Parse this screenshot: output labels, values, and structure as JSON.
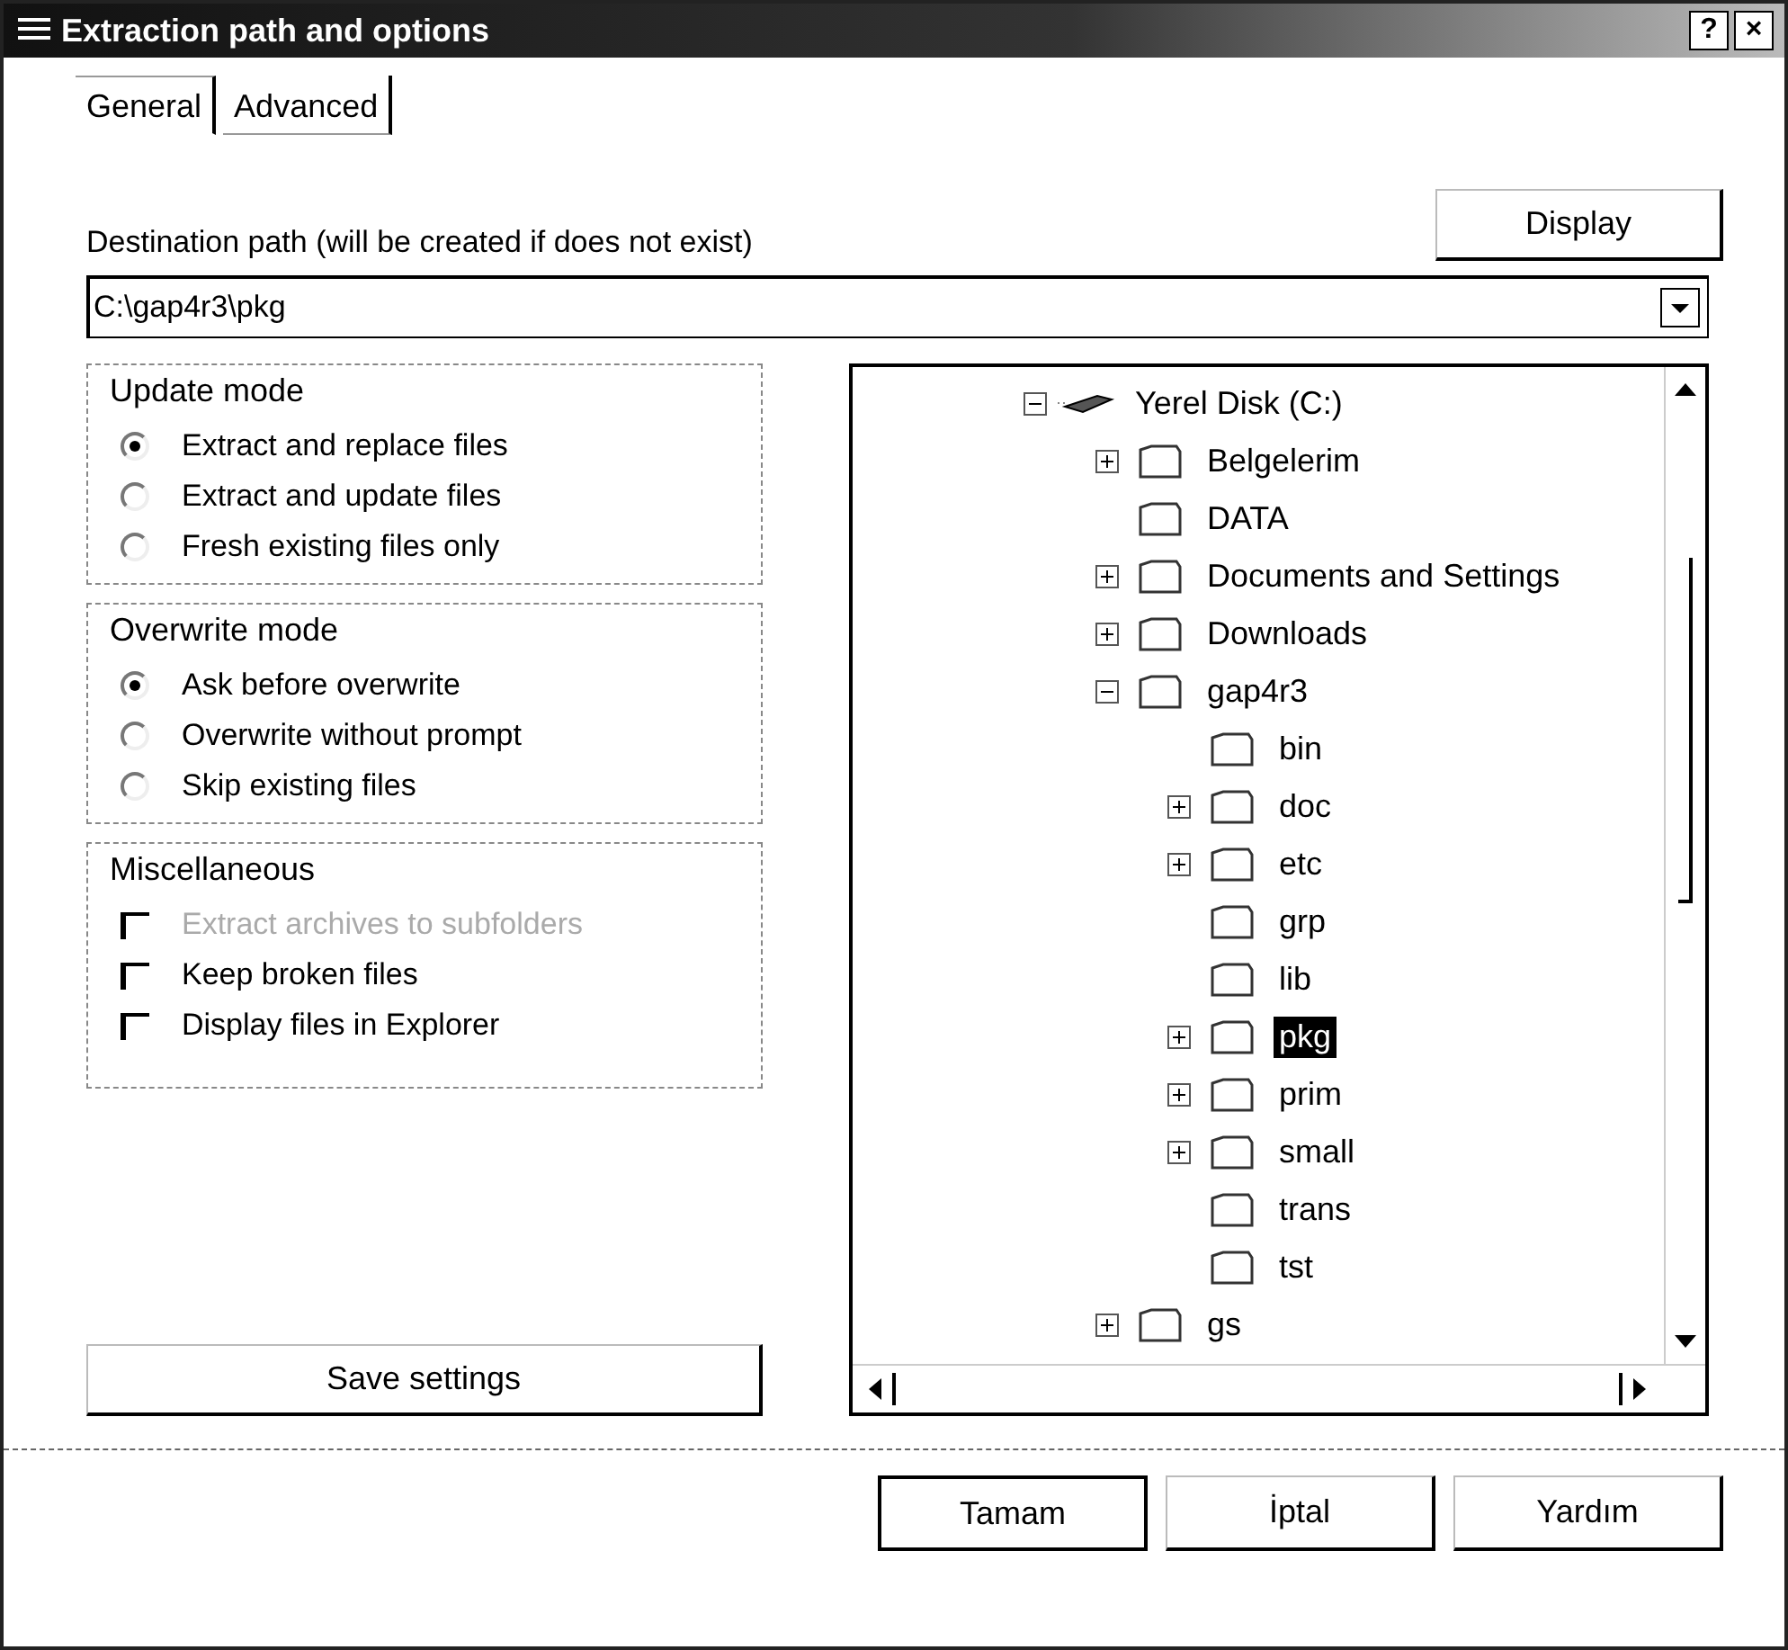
{
  "window": {
    "title": "Extraction path and options",
    "title_buttons": [
      "?",
      "×"
    ]
  },
  "tabs": [
    {
      "label": "General",
      "selected": true
    },
    {
      "label": "Advanced",
      "selected": false
    }
  ],
  "destination": {
    "label": "Destination path (will be created if does not exist)",
    "value": "C:\\gap4r3\\pkg",
    "display_button": "Display"
  },
  "update_mode": {
    "title": "Update mode",
    "options": [
      {
        "label": "Extract and replace files",
        "selected": true
      },
      {
        "label": "Extract and update files",
        "selected": false
      },
      {
        "label": "Fresh existing files only",
        "selected": false
      }
    ]
  },
  "overwrite_mode": {
    "title": "Overwrite mode",
    "options": [
      {
        "label": "Ask before overwrite",
        "selected": true
      },
      {
        "label": "Overwrite without prompt",
        "selected": false
      },
      {
        "label": "Skip existing files",
        "selected": false
      }
    ]
  },
  "miscellaneous": {
    "title": "Miscellaneous",
    "options": [
      {
        "label": "Extract archives to subfolders",
        "checked": false,
        "disabled": true
      },
      {
        "label": "Keep broken files",
        "checked": false,
        "disabled": false
      },
      {
        "label": "Display files in Explorer",
        "checked": false,
        "disabled": false
      }
    ]
  },
  "save_button": "Save settings",
  "tree": [
    {
      "label": "Yerel Disk (C:)",
      "kind": "drive",
      "expanded": true,
      "selected": false,
      "children": [
        {
          "label": "Belgelerim",
          "kind": "folder",
          "expanded": false,
          "selected": false
        },
        {
          "label": "DATA",
          "kind": "folder",
          "selected": false
        },
        {
          "label": "Documents and Settings",
          "kind": "folder",
          "expanded": false,
          "selected": false
        },
        {
          "label": "Downloads",
          "kind": "folder",
          "expanded": false,
          "selected": false
        },
        {
          "label": "gap4r3",
          "kind": "folder",
          "expanded": true,
          "selected": false,
          "children": [
            {
              "label": "bin",
              "kind": "folder",
              "selected": false
            },
            {
              "label": "doc",
              "kind": "folder",
              "expanded": false,
              "selected": false
            },
            {
              "label": "etc",
              "kind": "folder",
              "expanded": false,
              "selected": false
            },
            {
              "label": "grp",
              "kind": "folder",
              "selected": false
            },
            {
              "label": "lib",
              "kind": "folder",
              "selected": false
            },
            {
              "label": "pkg",
              "kind": "folder",
              "expanded": false,
              "selected": true
            },
            {
              "label": "prim",
              "kind": "folder",
              "expanded": false,
              "selected": false
            },
            {
              "label": "small",
              "kind": "folder",
              "expanded": false,
              "selected": false
            },
            {
              "label": "trans",
              "kind": "folder",
              "selected": false
            },
            {
              "label": "tst",
              "kind": "folder",
              "selected": false
            }
          ]
        },
        {
          "label": "gs",
          "kind": "folder",
          "expanded": false,
          "selected": false
        }
      ]
    }
  ],
  "buttons": [
    {
      "label": "Tamam",
      "default": true
    },
    {
      "label": "İptal",
      "default": false
    },
    {
      "label": "Yardım",
      "default": false
    }
  ]
}
